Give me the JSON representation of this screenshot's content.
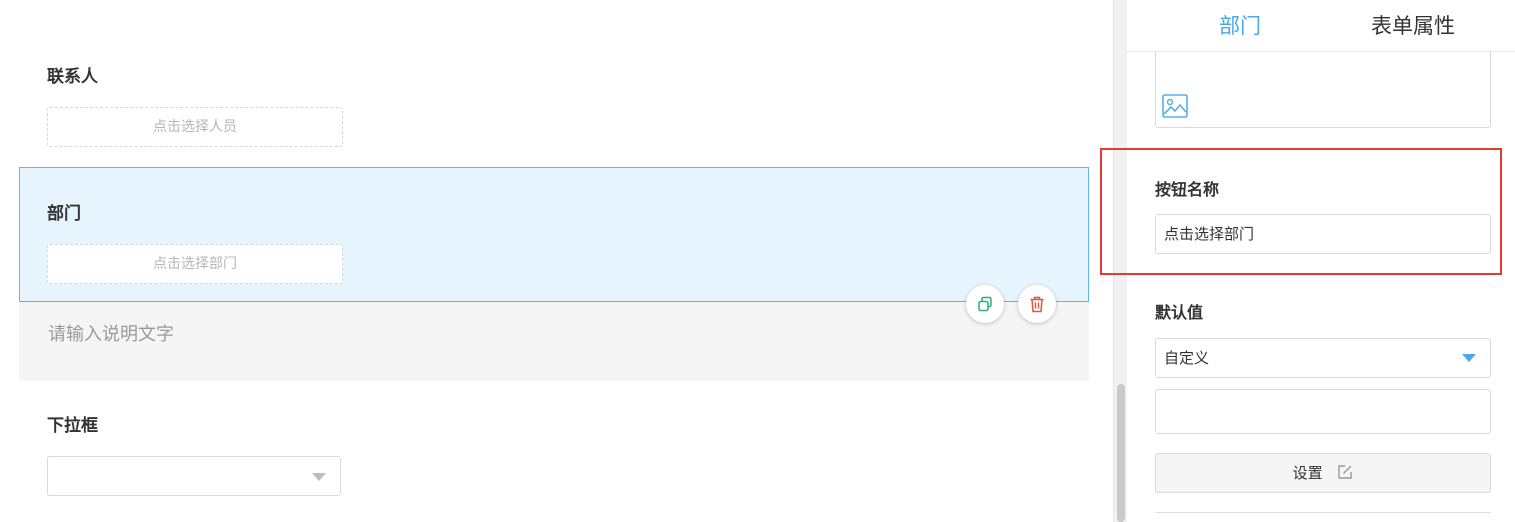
{
  "canvas": {
    "contact": {
      "label": "联系人",
      "button": "点击选择人员"
    },
    "department": {
      "label": "部门",
      "button": "点击选择部门"
    },
    "description_placeholder": "请输入说明文字",
    "dropdown": {
      "label": "下拉框",
      "value": ""
    }
  },
  "panel": {
    "tabs": [
      "部门",
      "表单属性"
    ],
    "active_tab": "部门",
    "button_name": {
      "label": "按钮名称",
      "value": "点击选择部门"
    },
    "default_value": {
      "label": "默认值",
      "selected": "自定义",
      "custom_value": ""
    },
    "settings_button": "设置"
  },
  "colors": {
    "accent": "#4aa8e6",
    "selected_bg": "#e6f4fd",
    "highlight_box": "#e53935",
    "copy_icon": "#2db07a",
    "delete_icon": "#e5533d"
  },
  "icons": {
    "copy": "copy-icon",
    "delete": "trash-icon",
    "image": "image-icon",
    "edit": "edit-icon"
  }
}
